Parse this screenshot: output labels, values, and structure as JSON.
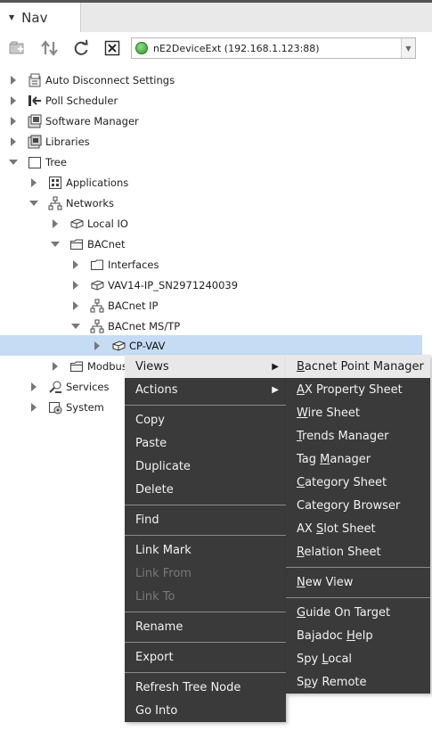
{
  "nav": {
    "title": "Nav"
  },
  "toolbar": {
    "station_select": "nE2DeviceExt (192.168.1.123:88)"
  },
  "tree": [
    {
      "label": "Auto Disconnect Settings",
      "icon": "settings-icon"
    },
    {
      "label": "Poll Scheduler",
      "icon": "poll-icon"
    },
    {
      "label": "Software Manager",
      "icon": "software-icon"
    },
    {
      "label": "Libraries",
      "icon": "library-icon"
    },
    {
      "label": "Tree",
      "icon": "folder-outline-icon"
    },
    {
      "label": "Applications",
      "icon": "apps-icon"
    },
    {
      "label": "Networks",
      "icon": "network-icon"
    },
    {
      "label": "Local IO",
      "icon": "device-icon"
    },
    {
      "label": "BACnet",
      "icon": "folder-icon"
    },
    {
      "label": "Interfaces",
      "icon": "folder-icon"
    },
    {
      "label": "VAV14-IP_SN2971240039",
      "icon": "device-icon"
    },
    {
      "label": "BACnet IP",
      "icon": "network-icon"
    },
    {
      "label": "BACnet MS/TP",
      "icon": "network-icon"
    },
    {
      "label": "CP-VAV",
      "icon": "device-icon"
    },
    {
      "label": "Modbus",
      "icon": "folder-icon"
    },
    {
      "label": "Services",
      "icon": "services-icon"
    },
    {
      "label": "System",
      "icon": "system-icon"
    }
  ],
  "context_menu": {
    "items": [
      "Views",
      "Actions",
      "Copy",
      "Paste",
      "Duplicate",
      "Delete",
      "Find",
      "Link Mark",
      "Link From",
      "Link To",
      "Rename",
      "Export",
      "Refresh Tree Node",
      "Go Into"
    ]
  },
  "views_submenu": {
    "items": [
      {
        "pre": "",
        "key": "B",
        "post": "acnet Point Manager"
      },
      {
        "pre": "",
        "key": "A",
        "post": "X Property Sheet"
      },
      {
        "pre": "",
        "key": "W",
        "post": "ire Sheet"
      },
      {
        "pre": "",
        "key": "T",
        "post": "rends Manager"
      },
      {
        "pre": "Tag ",
        "key": "M",
        "post": "anager"
      },
      {
        "pre": "",
        "key": "C",
        "post": "ategory Sheet"
      },
      {
        "pre": "Cate",
        "key": "g",
        "post": "ory Browser"
      },
      {
        "pre": "AX ",
        "key": "S",
        "post": "lot Sheet"
      },
      {
        "pre": "",
        "key": "R",
        "post": "elation Sheet"
      },
      {
        "pre": "",
        "key": "N",
        "post": "ew View"
      },
      {
        "pre": "",
        "key": "G",
        "post": "uide On Target"
      },
      {
        "pre": "Bajadoc ",
        "key": "H",
        "post": "elp"
      },
      {
        "pre": "Spy ",
        "key": "L",
        "post": "ocal"
      },
      {
        "pre": "S",
        "key": "p",
        "post": "y Remote"
      }
    ]
  }
}
